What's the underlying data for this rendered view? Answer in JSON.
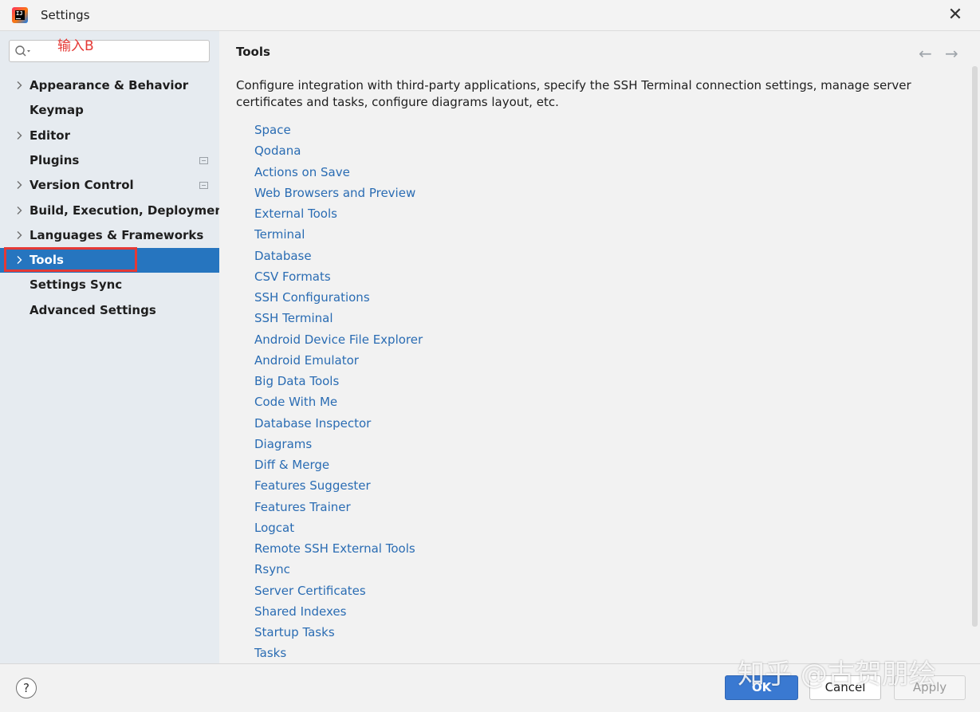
{
  "window": {
    "title": "Settings",
    "close_label": "✕"
  },
  "sidebar": {
    "search": {
      "value": "",
      "placeholder": ""
    },
    "annotation": "输入B",
    "items": [
      {
        "label": "Appearance & Behavior",
        "expandable": true,
        "selected": false,
        "badge": false
      },
      {
        "label": "Keymap",
        "expandable": false,
        "selected": false,
        "badge": false
      },
      {
        "label": "Editor",
        "expandable": true,
        "selected": false,
        "badge": false
      },
      {
        "label": "Plugins",
        "expandable": false,
        "selected": false,
        "badge": true
      },
      {
        "label": "Version Control",
        "expandable": true,
        "selected": false,
        "badge": true
      },
      {
        "label": "Build, Execution, Deployment",
        "expandable": true,
        "selected": false,
        "badge": false
      },
      {
        "label": "Languages & Frameworks",
        "expandable": true,
        "selected": false,
        "badge": false
      },
      {
        "label": "Tools",
        "expandable": true,
        "selected": true,
        "badge": false
      },
      {
        "label": "Settings Sync",
        "expandable": false,
        "selected": false,
        "badge": false
      },
      {
        "label": "Advanced Settings",
        "expandable": false,
        "selected": false,
        "badge": false
      }
    ]
  },
  "content": {
    "title": "Tools",
    "back_icon": "arrow-left-icon",
    "forward_icon": "arrow-right-icon",
    "description": "Configure integration with third-party applications, specify the SSH Terminal connection settings, manage server certificates and tasks, configure diagrams layout, etc.",
    "links": [
      "Space",
      "Qodana",
      "Actions on Save",
      "Web Browsers and Preview",
      "External Tools",
      "Terminal",
      "Database",
      "CSV Formats",
      "SSH Configurations",
      "SSH Terminal",
      "Android Device File Explorer",
      "Android Emulator",
      "Big Data Tools",
      "Code With Me",
      "Database Inspector",
      "Diagrams",
      "Diff & Merge",
      "Features Suggester",
      "Features Trainer",
      "Logcat",
      "Remote SSH External Tools",
      "Rsync",
      "Server Certificates",
      "Shared Indexes",
      "Startup Tasks",
      "Tasks"
    ]
  },
  "footer": {
    "help_label": "?",
    "ok_label": "OK",
    "cancel_label": "Cancel",
    "apply_label": "Apply"
  },
  "watermark": "知乎 @古贺朋绘",
  "colors": {
    "selection": "#2675bf",
    "link": "#2a6cb3",
    "annotation": "#e53935",
    "primary": "#3a79d1"
  }
}
